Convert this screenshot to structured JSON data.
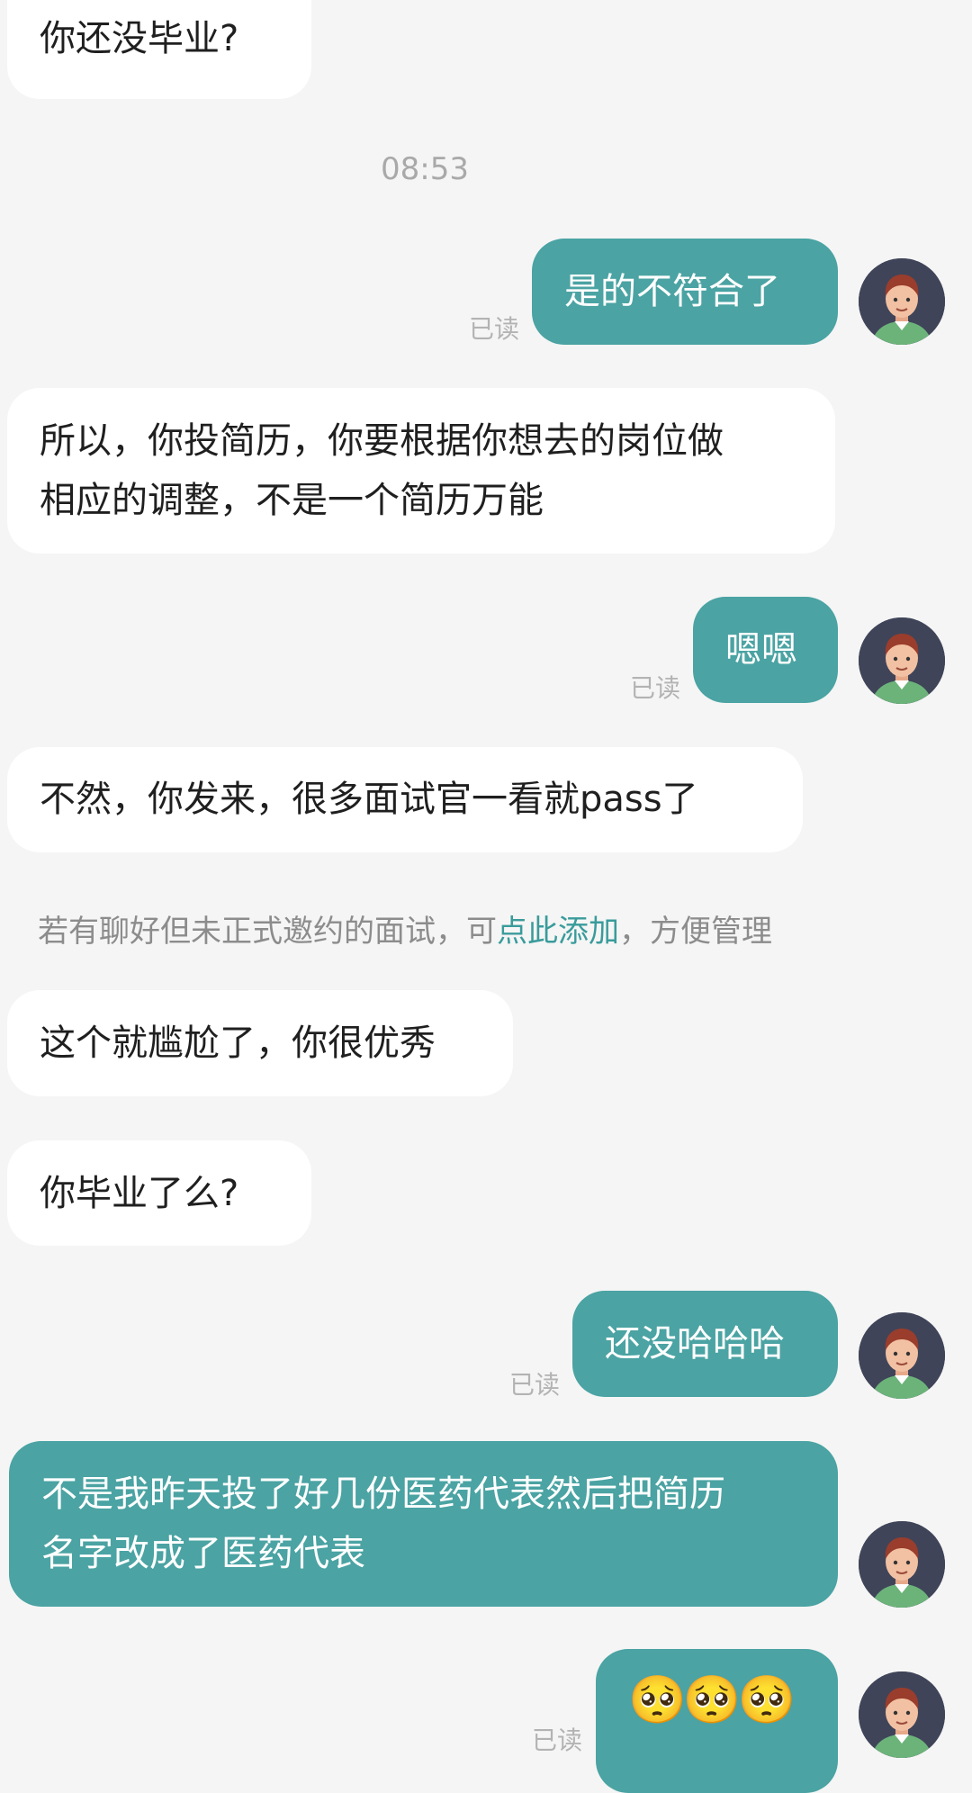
{
  "messages": {
    "m1": "你还没毕业?",
    "time1": "08:53",
    "m2": "是的不符合了",
    "m3": "所以，你投简历，你要根据你想去的岗位做\n相应的调整，不是一个简历万能",
    "m4": "嗯嗯",
    "m5": "不然，你发来，很多面试官一看就pass了",
    "m6": "这个就尴尬了，你很优秀",
    "m7": "你毕业了么?",
    "m8": "还没哈哈哈",
    "m9": "不是我昨天投了好几份医药代表然后把简历\n名字改成了医药代表",
    "m10_emoji": "🥺🥺🥺"
  },
  "read_label": "已读",
  "tip": {
    "prefix": "若有聊好但未正式邀约的面试，可",
    "link": "点此添加",
    "suffix": "，方便管理"
  },
  "colors": {
    "background": "#f5f5f5",
    "incoming_bubble": "#ffffff",
    "outgoing_bubble": "#4ba3a3",
    "link": "#3a9b9b"
  }
}
